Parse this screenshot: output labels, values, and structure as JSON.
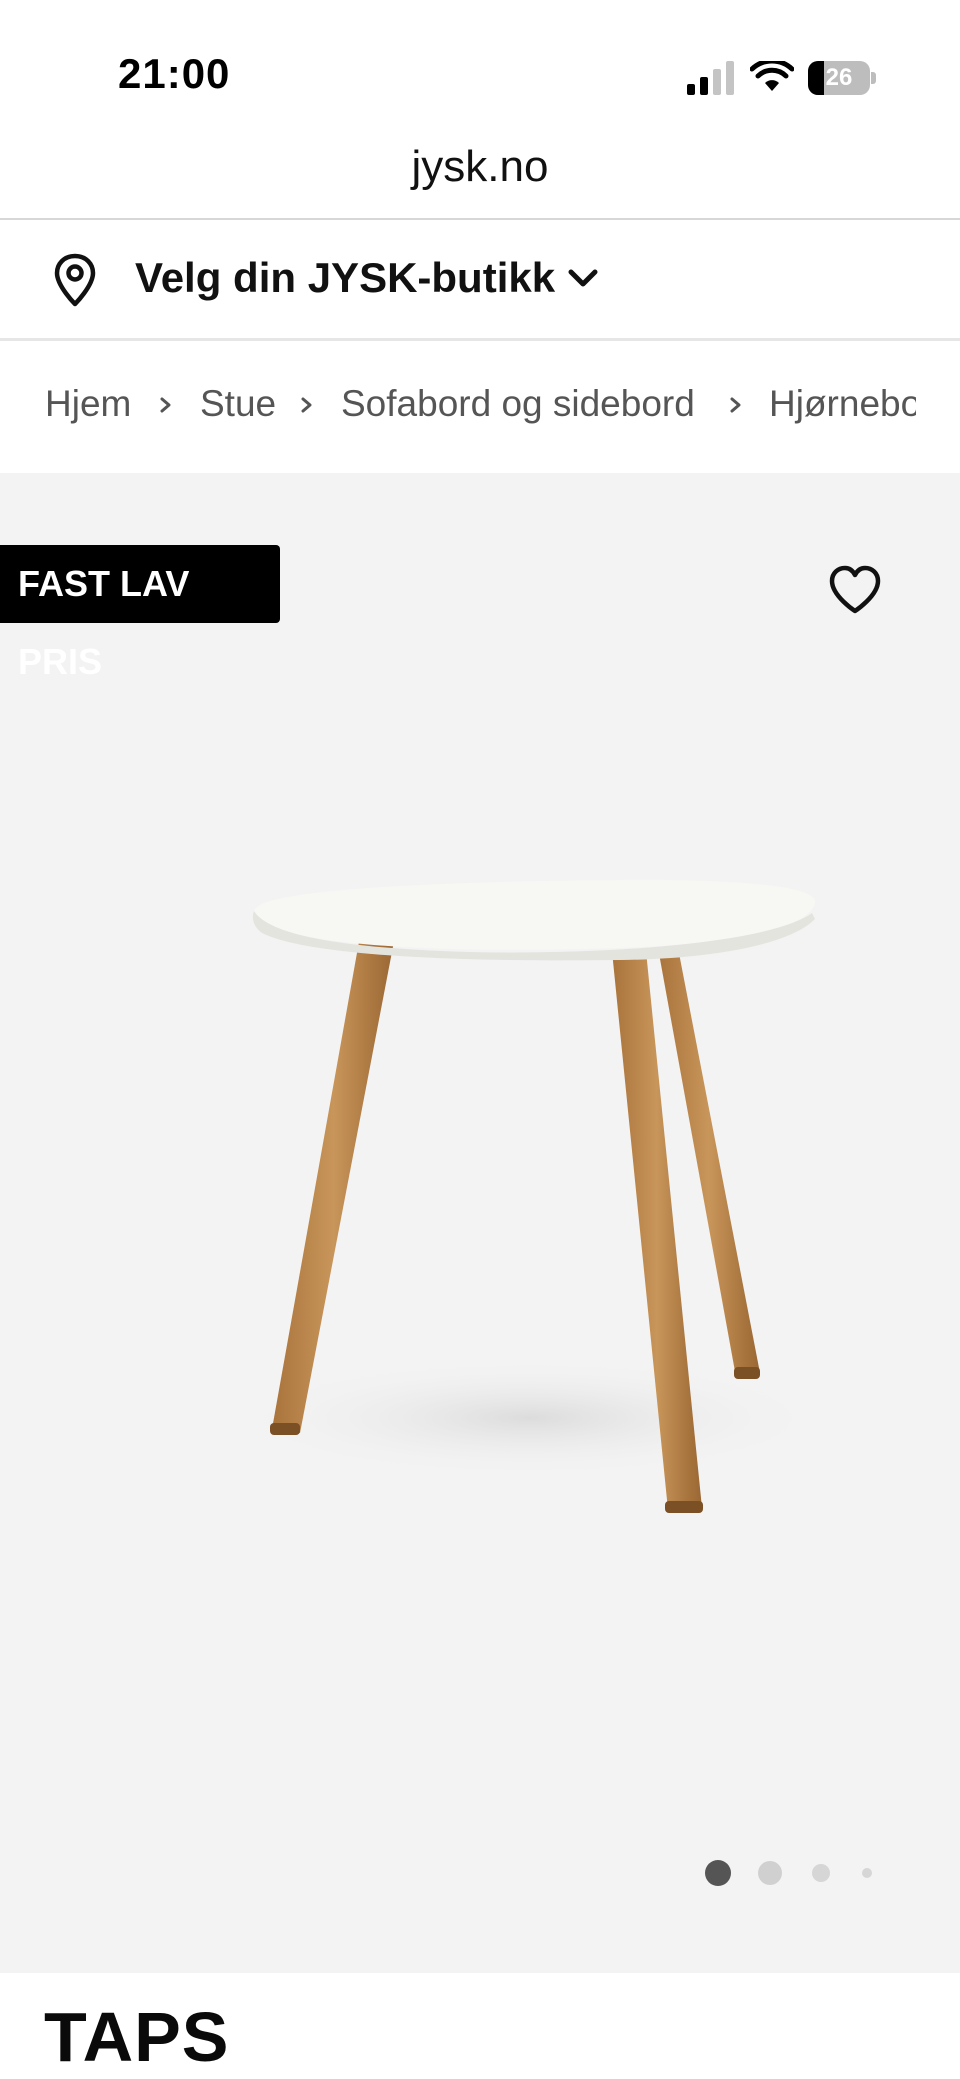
{
  "status_bar": {
    "time": "21:00",
    "battery_level": "26",
    "battery_percent": 26,
    "icons": [
      "signal-icon",
      "wifi-icon",
      "battery-icon"
    ]
  },
  "browser": {
    "url": "jysk.no"
  },
  "store_selector": {
    "label": "Velg din JYSK-butikk",
    "icons": [
      "location-pin-icon",
      "chevron-down-icon"
    ]
  },
  "breadcrumb": {
    "items": [
      "Hjem",
      "Stue",
      "Sofabord og sidebord",
      "Hjørnebord"
    ]
  },
  "gallery": {
    "badge": "FAST LAV PRIS",
    "favorite_icon": "heart-icon",
    "image_count": 4,
    "active_image": 1
  },
  "product": {
    "title": "TAPS"
  },
  "colors": {
    "badge_background": "#000000",
    "badge_text": "#ffffff",
    "gallery_background": "#f3f3f3",
    "breadcrumb_text": "#555555",
    "dot_active": "#555555",
    "dot_inactive": "#d0d0d0"
  }
}
